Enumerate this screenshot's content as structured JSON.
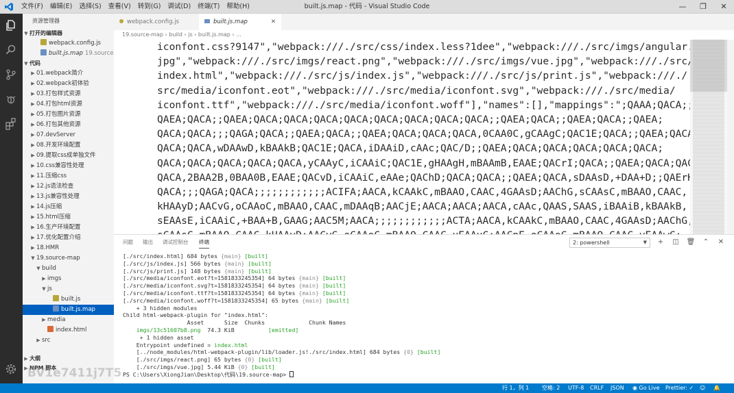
{
  "window": {
    "title": "built.js.map - 代码 - Visual Studio Code"
  },
  "menu": [
    "文件(F)",
    "编辑(E)",
    "选择(S)",
    "查看(V)",
    "转到(G)",
    "调试(D)",
    "终端(T)",
    "帮助(H)"
  ],
  "sidebar": {
    "title": "资源管理器",
    "open_editors_label": "打开的编辑器",
    "open_editors": [
      {
        "name": "webpack.config.js",
        "path": ""
      },
      {
        "name": "built.js.map",
        "path": "19.source-..."
      }
    ],
    "folder_label": "代码",
    "folders": [
      "01.webpack简介",
      "02.webpack初体验",
      "03.打包样式资源",
      "04.打包html资源",
      "05.打包图片资源",
      "06.打包其他资源",
      "07.devServer",
      "08.开发环境配置",
      "09.提取css成单独文件",
      "10.css兼容性处理",
      "11.压缩css",
      "12.js语法检查",
      "13.js兼容性处理",
      "14.js压缩",
      "15.html压缩",
      "16.生产环境配置",
      "17.优化配置介绍",
      "18.HMR",
      "19.source-map"
    ],
    "tree": [
      {
        "label": "build",
        "depth": 1,
        "icon": "chevron",
        "open": true
      },
      {
        "label": "imgs",
        "depth": 2,
        "icon": "chevron",
        "open": false
      },
      {
        "label": "js",
        "depth": 2,
        "icon": "chevron",
        "open": true
      },
      {
        "label": "built.js",
        "depth": 3,
        "icon": "js-file",
        "open": null
      },
      {
        "label": "built.js.map",
        "depth": 3,
        "icon": "map-file",
        "open": null,
        "selected": true
      },
      {
        "label": "media",
        "depth": 2,
        "icon": "chevron",
        "open": false
      },
      {
        "label": "index.html",
        "depth": 2,
        "icon": "html-file",
        "open": null
      },
      {
        "label": "src",
        "depth": 1,
        "icon": "chevron",
        "open": false
      }
    ],
    "outline_label": "大纲",
    "npm_label": "NPM 脚本"
  },
  "tabs": [
    {
      "label": "webpack.config.js",
      "active": false
    },
    {
      "label": "built.js.map",
      "active": true
    }
  ],
  "breadcrumb": [
    "19.source-map",
    "build",
    "js",
    "built.js.map",
    "..."
  ],
  "editor": {
    "lines": [
      "iconfont.css?9147\",\"webpack:///./src/css/index.less?1dee\",\"webpack:///./src/imgs/angular.",
      "jpg\",\"webpack:///./src/imgs/react.png\",\"webpack:///./src/imgs/vue.jpg\",\"webpack:///./src/",
      "index.html\",\"webpack:///./src/js/index.js\",\"webpack:///./src/js/print.js\",\"webpack:///./",
      "src/media/iconfont.eot\",\"webpack:///./src/media/iconfont.svg\",\"webpack:///./src/media/",
      "iconfont.ttf\",\"webpack:///./src/media/iconfont.woff\"],\"names\":[],\"mappings\":\";QAAA;QACA;;",
      "QAEA;QACA;;QAEA;QACA;QACA;QACA;QACA;QACA;QACA;QACA;QACA;;QAEA;QACA;;QAEA;QACA;;QAEA;",
      "QACA;QACA;;;QAGA;QACA;;QAEA;QACA;;QAEA;QACA;QACA;QACA,0CAA0C,gCAAgC;QAC1E;QACA;;QAEA;QACA;",
      "QACA;QACA,wDAAwD,kBAAkB;QAC1E;QACA,iDAAiD,cAAc;QAC/D;;QAEA;QACA;QACA;QACA;QACA;QACA;",
      "QACA;QACA;QACA;QACA;QACA,yCAAyC,iCAAiC;QAC1E,gHAAgH,mBAAmB,EAAE;QACrI;QACA;;QAEA;QACA;QACA;",
      "QACA,2BAA2B,0BAA0B,EAAE;QACvD,iCAAiC,eAAe;QAChD;QACA;QACA;;QAEA;QACA,sDAAsD,+DAA+D;;QAErH;",
      "QACA;;;QAGA;QACA;;;;;;;;;;;;ACIFA;AACA,kCAAkC,mBAAO,CAAC,4GAAsD;AAChG,sCAAsC,mBAAO,CAAC,",
      "kHAAyD;AACvG,oCAAoC,mBAAO,CAAC,mDAAqB;AACjE;AACA;AACA;AACA,cAAc,QAAS,SAAS,iBAAiB,kBAAkB,",
      "sEAAsE,iCAAiC,+BAA+B,GAAG;AAC5M;AACA;;;;;;;;;;;;ACTA;AACA,kCAAkC,mBAAO,CAAC,4GAAsD;AAChG,",
      "sCAAsC,mBAAO,CAAC,kHAAyD;AACvG,oCAAoC,mBAAO,CAAC,uEAAuC;AACnE,oCAAoC,mBAAO,CAAC,vEAAwC;"
    ]
  },
  "panel": {
    "tabs": [
      "问题",
      "输出",
      "调试控制台",
      "终端"
    ],
    "active_tab": "终端",
    "terminal_select": "2: powershell",
    "terminal_lines": [
      {
        "segs": [
          {
            "t": "[./src/index.html] 684 bytes ",
            "c": ""
          },
          {
            "t": "{main}",
            "c": "t-grey"
          },
          {
            "t": " [built]",
            "c": "t-green"
          }
        ]
      },
      {
        "segs": [
          {
            "t": "[./src/js/index.js] 566 bytes ",
            "c": ""
          },
          {
            "t": "{main}",
            "c": "t-grey"
          },
          {
            "t": " [built]",
            "c": "t-green"
          }
        ]
      },
      {
        "segs": [
          {
            "t": "[./src/js/print.js] 148 bytes ",
            "c": ""
          },
          {
            "t": "{main}",
            "c": "t-grey"
          },
          {
            "t": " [built]",
            "c": "t-green"
          }
        ]
      },
      {
        "segs": [
          {
            "t": "[./src/media/iconfont.eot?t=1581833245354] 64 bytes ",
            "c": ""
          },
          {
            "t": "{main}",
            "c": "t-grey"
          },
          {
            "t": " [built]",
            "c": "t-green"
          }
        ]
      },
      {
        "segs": [
          {
            "t": "[./src/media/iconfont.svg?t=1581833245354] 64 bytes ",
            "c": ""
          },
          {
            "t": "{main}",
            "c": "t-grey"
          },
          {
            "t": " [built]",
            "c": "t-green"
          }
        ]
      },
      {
        "segs": [
          {
            "t": "[./src/media/iconfont.ttf?t=1581833245354] 64 bytes ",
            "c": ""
          },
          {
            "t": "{main}",
            "c": "t-grey"
          },
          {
            "t": " [built]",
            "c": "t-green"
          }
        ]
      },
      {
        "segs": [
          {
            "t": "[./src/media/iconfont.woff?t=1581833245354] 65 bytes ",
            "c": ""
          },
          {
            "t": "{main}",
            "c": "t-grey"
          },
          {
            "t": " [built]",
            "c": "t-green"
          }
        ]
      },
      {
        "segs": [
          {
            "t": "    + 3 hidden modules",
            "c": ""
          }
        ]
      },
      {
        "segs": [
          {
            "t": "Child html-webpack-plugin for \"index.html\":",
            "c": ""
          }
        ]
      },
      {
        "segs": [
          {
            "t": "                   Asset      Size  Chunks             Chunk Names",
            "c": ""
          }
        ]
      },
      {
        "segs": [
          {
            "t": "    imgs/13c51607b8.png",
            "c": "t-green"
          },
          {
            "t": "  74.3 KiB          ",
            "c": ""
          },
          {
            "t": "[emitted]",
            "c": "t-green"
          }
        ]
      },
      {
        "segs": [
          {
            "t": "     + 1 hidden asset",
            "c": ""
          }
        ]
      },
      {
        "segs": [
          {
            "t": "    Entrypoint ",
            "c": ""
          },
          {
            "t": "undefined",
            "c": ""
          },
          {
            "t": " = ",
            "c": ""
          },
          {
            "t": "index.html",
            "c": "t-green"
          }
        ]
      },
      {
        "segs": [
          {
            "t": "    [../node_modules/html-webpack-plugin/lib/loader.js!./src/index.html] 684 bytes ",
            "c": ""
          },
          {
            "t": "{0}",
            "c": "t-grey"
          },
          {
            "t": " [built]",
            "c": "t-green"
          }
        ]
      },
      {
        "segs": [
          {
            "t": "    [./src/imgs/react.png] 65 bytes ",
            "c": ""
          },
          {
            "t": "{0}",
            "c": "t-grey"
          },
          {
            "t": " [built]",
            "c": "t-green"
          }
        ]
      },
      {
        "segs": [
          {
            "t": "    [./src/imgs/vue.jpg] 5.44 KiB ",
            "c": ""
          },
          {
            "t": "{0}",
            "c": "t-grey"
          },
          {
            "t": " [built]",
            "c": "t-green"
          }
        ]
      },
      {
        "segs": [
          {
            "t": "PS C:\\Users\\XiongJian\\Desktop\\代码\\19.source-map> ",
            "c": ""
          }
        ]
      }
    ]
  },
  "statusbar": {
    "left": "",
    "position": "行 1，列 1",
    "spaces": "空格: 2",
    "encoding": "UTF-8",
    "eol": "CRLF",
    "language": "JSON",
    "golive": "Go Live",
    "prettier": "Prettier: ✓"
  },
  "watermark": "BV1e7411j7T5",
  "colors": {
    "accent": "#007acc",
    "selection": "#0060c0",
    "activity_bar": "#2c2c2c",
    "terminal_green": "#2aa22a"
  }
}
